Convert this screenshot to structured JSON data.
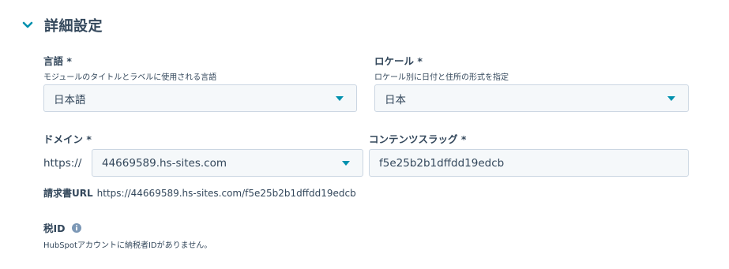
{
  "section": {
    "title": "詳細設定",
    "toggle_icon": "chevron-down-icon"
  },
  "language": {
    "label": "言語 *",
    "help": "モジュールのタイトルとラベルに使用される言語",
    "value": "日本語"
  },
  "locale": {
    "label": "ロケール *",
    "help": "ロケール別に日付と住所の形式を指定",
    "value": "日本"
  },
  "domain": {
    "label": "ドメイン *",
    "prefix": "https://",
    "value": "44669589.hs-sites.com"
  },
  "slug": {
    "label": "コンテンツスラッグ *",
    "value": "f5e25b2b1dffdd19edcb"
  },
  "invoice_url": {
    "label": "請求書URL",
    "value": "https://44669589.hs-sites.com/f5e25b2b1dffdd19edcb"
  },
  "tax_id": {
    "label": "税ID",
    "help": "HubSpotアカウントに納税者IDがありません。",
    "info_icon": "info-icon"
  },
  "colors": {
    "text": "#33475b",
    "accent": "#0091ae",
    "field_bg": "#f5f8fa",
    "field_border": "#cbd6e2"
  }
}
